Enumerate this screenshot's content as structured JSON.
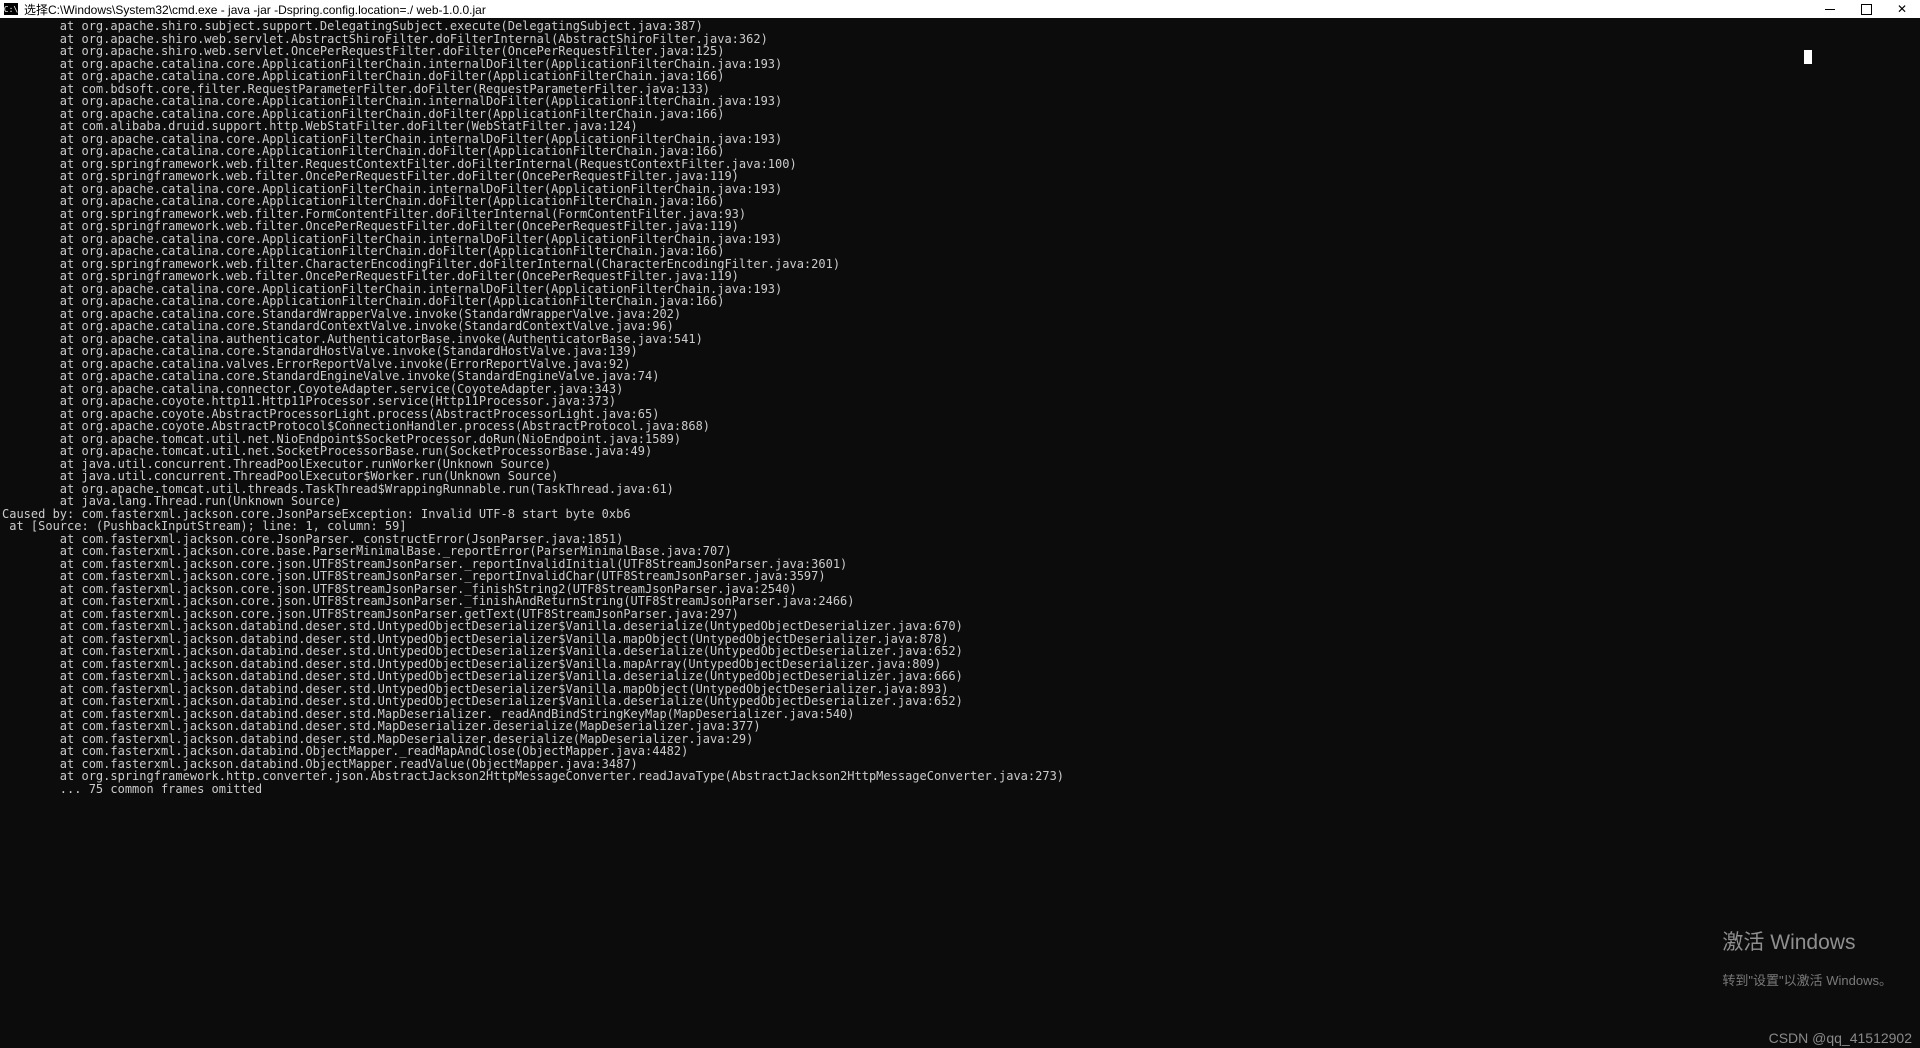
{
  "window": {
    "title": "选择C:\\Windows\\System32\\cmd.exe - java  -jar -Dspring.config.location=./ web-1.0.0.jar"
  },
  "watermark": {
    "line1": "激活 Windows",
    "line2": "转到\"设置\"以激活 Windows。"
  },
  "csdn": "CSDN @qq_41512902",
  "stack": {
    "indent_at": "        at ",
    "frames_top": [
      "org.apache.shiro.subject.support.DelegatingSubject.execute(DelegatingSubject.java:387)",
      "org.apache.shiro.web.servlet.AbstractShiroFilter.doFilterInternal(AbstractShiroFilter.java:362)",
      "org.apache.shiro.web.servlet.OncePerRequestFilter.doFilter(OncePerRequestFilter.java:125)",
      "org.apache.catalina.core.ApplicationFilterChain.internalDoFilter(ApplicationFilterChain.java:193)",
      "org.apache.catalina.core.ApplicationFilterChain.doFilter(ApplicationFilterChain.java:166)",
      "com.bdsoft.core.filter.RequestParameterFilter.doFilter(RequestParameterFilter.java:133)",
      "org.apache.catalina.core.ApplicationFilterChain.internalDoFilter(ApplicationFilterChain.java:193)",
      "org.apache.catalina.core.ApplicationFilterChain.doFilter(ApplicationFilterChain.java:166)",
      "com.alibaba.druid.support.http.WebStatFilter.doFilter(WebStatFilter.java:124)",
      "org.apache.catalina.core.ApplicationFilterChain.internalDoFilter(ApplicationFilterChain.java:193)",
      "org.apache.catalina.core.ApplicationFilterChain.doFilter(ApplicationFilterChain.java:166)",
      "org.springframework.web.filter.RequestContextFilter.doFilterInternal(RequestContextFilter.java:100)",
      "org.springframework.web.filter.OncePerRequestFilter.doFilter(OncePerRequestFilter.java:119)",
      "org.apache.catalina.core.ApplicationFilterChain.internalDoFilter(ApplicationFilterChain.java:193)",
      "org.apache.catalina.core.ApplicationFilterChain.doFilter(ApplicationFilterChain.java:166)",
      "org.springframework.web.filter.FormContentFilter.doFilterInternal(FormContentFilter.java:93)",
      "org.springframework.web.filter.OncePerRequestFilter.doFilter(OncePerRequestFilter.java:119)",
      "org.apache.catalina.core.ApplicationFilterChain.internalDoFilter(ApplicationFilterChain.java:193)",
      "org.apache.catalina.core.ApplicationFilterChain.doFilter(ApplicationFilterChain.java:166)",
      "org.springframework.web.filter.CharacterEncodingFilter.doFilterInternal(CharacterEncodingFilter.java:201)",
      "org.springframework.web.filter.OncePerRequestFilter.doFilter(OncePerRequestFilter.java:119)",
      "org.apache.catalina.core.ApplicationFilterChain.internalDoFilter(ApplicationFilterChain.java:193)",
      "org.apache.catalina.core.ApplicationFilterChain.doFilter(ApplicationFilterChain.java:166)",
      "org.apache.catalina.core.StandardWrapperValve.invoke(StandardWrapperValve.java:202)",
      "org.apache.catalina.core.StandardContextValve.invoke(StandardContextValve.java:96)",
      "org.apache.catalina.authenticator.AuthenticatorBase.invoke(AuthenticatorBase.java:541)",
      "org.apache.catalina.core.StandardHostValve.invoke(StandardHostValve.java:139)",
      "org.apache.catalina.valves.ErrorReportValve.invoke(ErrorReportValve.java:92)",
      "org.apache.catalina.core.StandardEngineValve.invoke(StandardEngineValve.java:74)",
      "org.apache.catalina.connector.CoyoteAdapter.service(CoyoteAdapter.java:343)",
      "org.apache.coyote.http11.Http11Processor.service(Http11Processor.java:373)",
      "org.apache.coyote.AbstractProcessorLight.process(AbstractProcessorLight.java:65)",
      "org.apache.coyote.AbstractProtocol$ConnectionHandler.process(AbstractProtocol.java:868)",
      "org.apache.tomcat.util.net.NioEndpoint$SocketProcessor.doRun(NioEndpoint.java:1589)",
      "org.apache.tomcat.util.net.SocketProcessorBase.run(SocketProcessorBase.java:49)",
      "java.util.concurrent.ThreadPoolExecutor.runWorker(Unknown Source)",
      "java.util.concurrent.ThreadPoolExecutor$Worker.run(Unknown Source)",
      "org.apache.tomcat.util.threads.TaskThread$WrappingRunnable.run(TaskThread.java:61)",
      "java.lang.Thread.run(Unknown Source)"
    ],
    "caused_by": "Caused by: com.fasterxml.jackson.core.JsonParseException: Invalid UTF-8 start byte 0xb6",
    "source_line": " at [Source: (PushbackInputStream); line: 1, column: 59]",
    "frames_cause": [
      "com.fasterxml.jackson.core.JsonParser._constructError(JsonParser.java:1851)",
      "com.fasterxml.jackson.core.base.ParserMinimalBase._reportError(ParserMinimalBase.java:707)",
      "com.fasterxml.jackson.core.json.UTF8StreamJsonParser._reportInvalidInitial(UTF8StreamJsonParser.java:3601)",
      "com.fasterxml.jackson.core.json.UTF8StreamJsonParser._reportInvalidChar(UTF8StreamJsonParser.java:3597)",
      "com.fasterxml.jackson.core.json.UTF8StreamJsonParser._finishString2(UTF8StreamJsonParser.java:2540)",
      "com.fasterxml.jackson.core.json.UTF8StreamJsonParser._finishAndReturnString(UTF8StreamJsonParser.java:2466)",
      "com.fasterxml.jackson.core.json.UTF8StreamJsonParser.getText(UTF8StreamJsonParser.java:297)",
      "com.fasterxml.jackson.databind.deser.std.UntypedObjectDeserializer$Vanilla.deserialize(UntypedObjectDeserializer.java:670)",
      "com.fasterxml.jackson.databind.deser.std.UntypedObjectDeserializer$Vanilla.mapObject(UntypedObjectDeserializer.java:878)",
      "com.fasterxml.jackson.databind.deser.std.UntypedObjectDeserializer$Vanilla.deserialize(UntypedObjectDeserializer.java:652)",
      "com.fasterxml.jackson.databind.deser.std.UntypedObjectDeserializer$Vanilla.mapArray(UntypedObjectDeserializer.java:809)",
      "com.fasterxml.jackson.databind.deser.std.UntypedObjectDeserializer$Vanilla.deserialize(UntypedObjectDeserializer.java:666)",
      "com.fasterxml.jackson.databind.deser.std.UntypedObjectDeserializer$Vanilla.mapObject(UntypedObjectDeserializer.java:893)",
      "com.fasterxml.jackson.databind.deser.std.UntypedObjectDeserializer$Vanilla.deserialize(UntypedObjectDeserializer.java:652)",
      "com.fasterxml.jackson.databind.deser.std.MapDeserializer._readAndBindStringKeyMap(MapDeserializer.java:540)",
      "com.fasterxml.jackson.databind.deser.std.MapDeserializer.deserialize(MapDeserializer.java:377)",
      "com.fasterxml.jackson.databind.deser.std.MapDeserializer.deserialize(MapDeserializer.java:29)",
      "com.fasterxml.jackson.databind.ObjectMapper._readMapAndClose(ObjectMapper.java:4482)",
      "com.fasterxml.jackson.databind.ObjectMapper.readValue(ObjectMapper.java:3487)",
      "org.springframework.http.converter.json.AbstractJackson2HttpMessageConverter.readJavaType(AbstractJackson2HttpMessageConverter.java:273)"
    ],
    "omitted": "        ... 75 common frames omitted"
  }
}
